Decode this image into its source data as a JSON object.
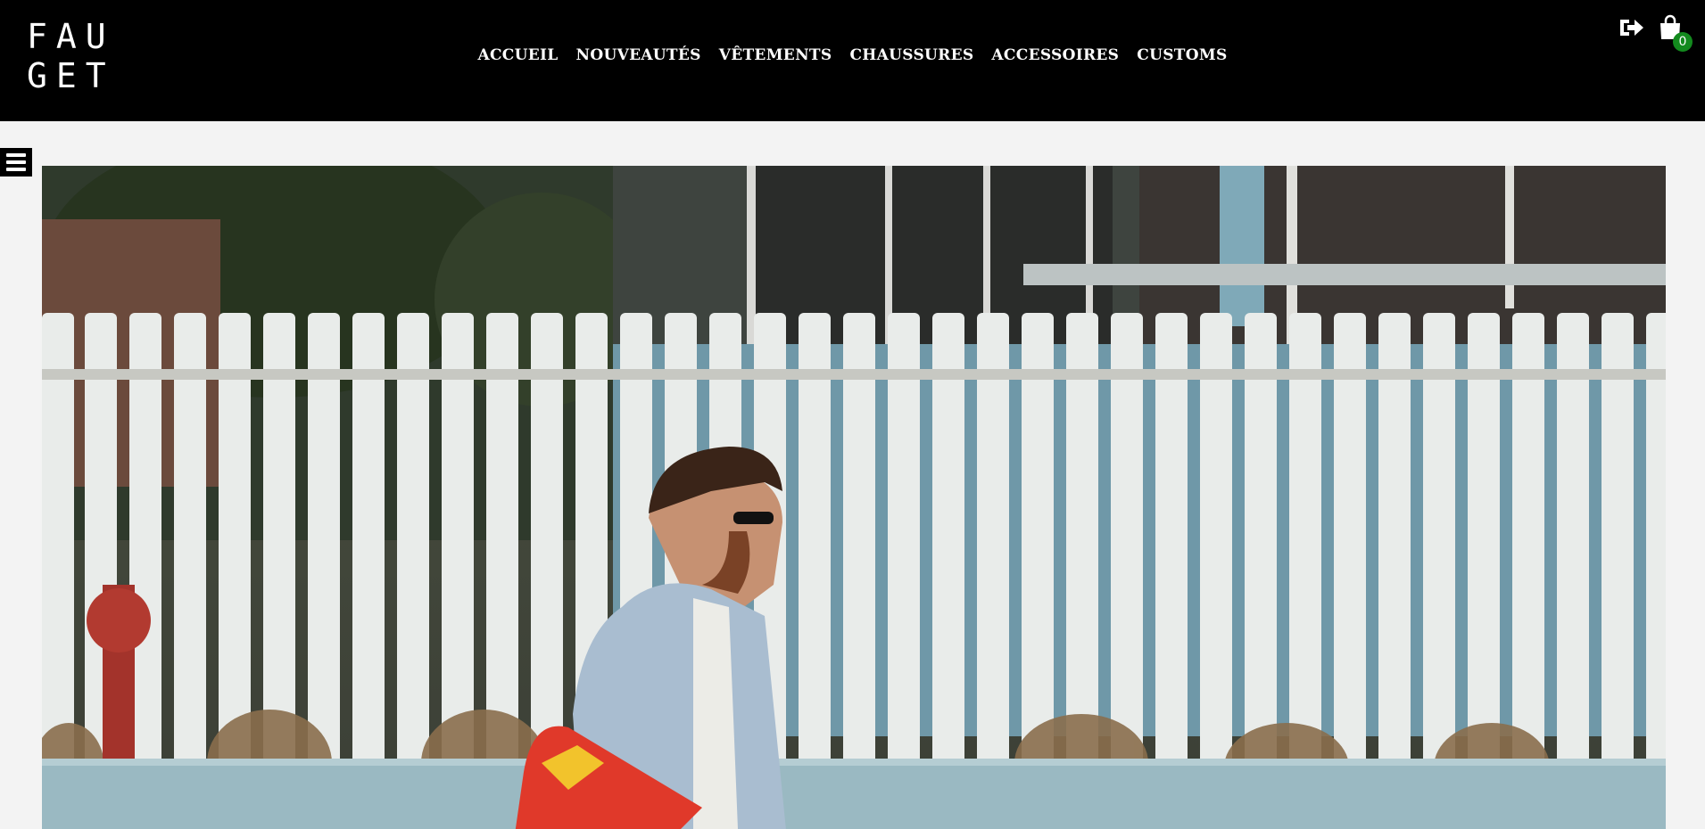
{
  "brand": {
    "logo_line1": "FAU",
    "logo_line2": "GET"
  },
  "nav": {
    "items": [
      {
        "label": "ACCUEIL"
      },
      {
        "label": "NOUVEAUTÉS"
      },
      {
        "label": "VÊTEMENTS"
      },
      {
        "label": "CHAUSSURES"
      },
      {
        "label": "ACCESSOIRES"
      },
      {
        "label": "CUSTOMS"
      }
    ]
  },
  "header": {
    "logout_icon": "sign-out-icon",
    "cart_icon": "shopping-bag-icon",
    "cart_count": "0"
  },
  "sidebar": {
    "toggle_icon": "hamburger-menu-icon"
  },
  "hero": {
    "image_subject": "hero-banner-image"
  },
  "colors": {
    "header_bg": "#000000",
    "page_bg": "#f3f3f3",
    "badge": "#138a1e"
  }
}
